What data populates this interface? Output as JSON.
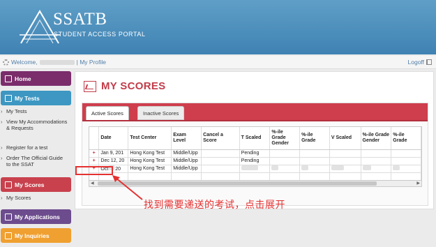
{
  "header": {
    "brand": "SSATB",
    "tagline": "STUDENT ACCESS PORTAL"
  },
  "topbar": {
    "welcome": "Welcome,",
    "profile_link": "| My Profile",
    "logoff": "Logoff"
  },
  "sidebar": {
    "home": "Home",
    "my_tests": "My Tests",
    "my_tests_items": [
      "My Tests",
      "View My Accommodations & Requests",
      "Register for a test",
      "Order The Official Guide to the SSAT"
    ],
    "my_scores": "My Scores",
    "my_scores_items": [
      "My Scores"
    ],
    "my_applications": "My Applications",
    "my_inquiries": "My Inquiries"
  },
  "main": {
    "title": "MY SCORES",
    "tabs": [
      "Active Scores",
      "Inactive Scores"
    ],
    "columns": [
      "Date",
      "Test Center",
      "Exam Level",
      "Cancel a Score",
      "T Scaled",
      "%-ile Grade Gender",
      "%-ile Grade",
      "V Scaled",
      "%-ile Grade Gender",
      "%-ile Grade"
    ],
    "rows": [
      {
        "expand": "+",
        "date": "Jan 9, 201",
        "center": "Hong Kong Test",
        "level": "Middle/Upp",
        "cancel": "",
        "tscaled": "Pending"
      },
      {
        "expand": "+",
        "date": "Dec 12, 20",
        "center": "Hong Kong Test",
        "level": "Middle/Upp",
        "cancel": "",
        "tscaled": "Pending"
      },
      {
        "expand": "+",
        "date": "Oct",
        "date2": "20",
        "center": "Hong Kong Test",
        "level": "Middle/Upp",
        "cancel": "",
        "tscaled": ""
      }
    ]
  },
  "annotation": {
    "text": "找到需要递送的考试，点击展开"
  },
  "colors": {
    "header": "#4a8dbd",
    "accent_red": "#c23c4a",
    "home": "#7b2d6b",
    "my_tests": "#3d97c2",
    "my_scores": "#c8414d",
    "my_applications": "#6d4c8e",
    "my_inquiries": "#f0a030",
    "annotation": "#e53131"
  }
}
